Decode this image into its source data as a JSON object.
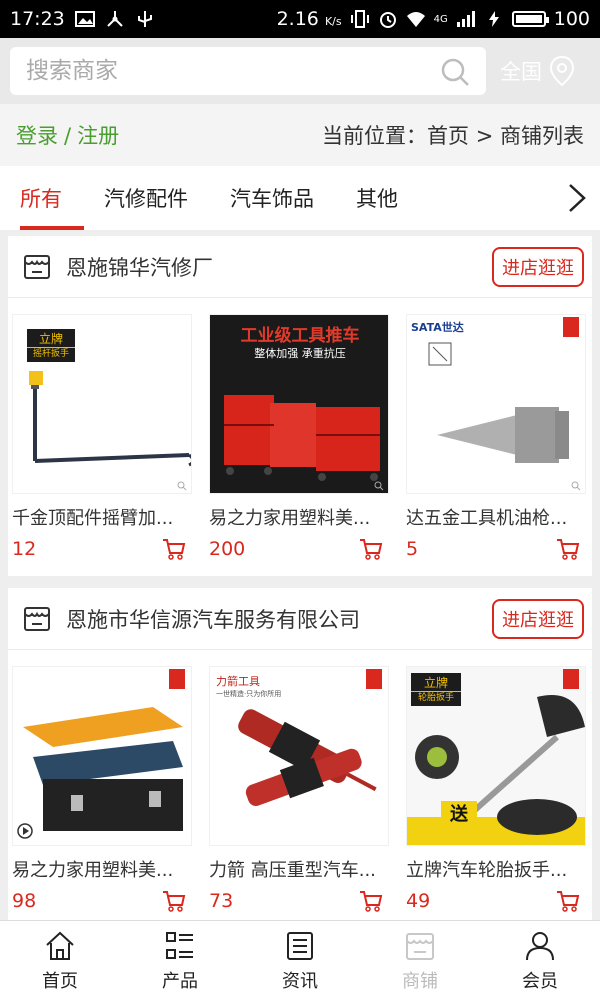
{
  "status_bar": {
    "time": "17:23",
    "speed": "2.16",
    "speed_unit": "K/s",
    "network": "4G",
    "battery_level": 100,
    "battery": "100"
  },
  "search": {
    "placeholder": "搜索商家",
    "region_label": "全国"
  },
  "account": {
    "login_label": "登录",
    "separator": "/",
    "register_label": "注册"
  },
  "breadcrumb": "当前位置：首页 > 商铺列表",
  "tabs": [
    {
      "label": "所有",
      "active": true
    },
    {
      "label": "汽修配件",
      "active": false
    },
    {
      "label": "汽车饰品",
      "active": false
    },
    {
      "label": "其他",
      "active": false
    }
  ],
  "stores": [
    {
      "name": "恩施锦华汽修厂",
      "visit_label": "进店逛逛",
      "products": [
        {
          "title": "千金顶配件摇臂加...",
          "price": "12",
          "image": "wrench-handle",
          "brand": "立牌",
          "brand_sub": "摇杆扳手"
        },
        {
          "title": "易之力家用塑料美...",
          "price": "200",
          "image": "tool-cart",
          "banner": "工业级工具推车",
          "banner_sub": "整体加强 承重抗压"
        },
        {
          "title": "达五金工具机油枪...",
          "price": "5",
          "image": "oil-nozzle",
          "brand": "SATA世达"
        }
      ]
    },
    {
      "name": "恩施市华信源汽车服务有限公司",
      "visit_label": "进店逛逛",
      "products": [
        {
          "title": "易之力家用塑料美...",
          "price": "98",
          "image": "toolbox"
        },
        {
          "title": "力箭 高压重型汽车...",
          "price": "73",
          "image": "grease-gun",
          "brand": "力箭工具",
          "brand_sub": "一世精造·只为你所用"
        },
        {
          "title": "立牌汽车轮胎扳手...",
          "price": "49",
          "image": "tire-wrench",
          "brand": "立牌",
          "brand_sub": "轮胎扳手",
          "tag": "送"
        }
      ]
    }
  ],
  "bottom_nav": [
    {
      "label": "首页",
      "icon": "home-icon",
      "active": false
    },
    {
      "label": "产品",
      "icon": "grid-list-icon",
      "active": false
    },
    {
      "label": "资讯",
      "icon": "news-icon",
      "active": false
    },
    {
      "label": "商铺",
      "icon": "shop-icon",
      "active": true
    },
    {
      "label": "会员",
      "icon": "user-icon",
      "active": false
    }
  ],
  "colors": {
    "accent": "#d9281e",
    "login_green": "#4a9d2f",
    "page_bg": "#eeeeee"
  }
}
